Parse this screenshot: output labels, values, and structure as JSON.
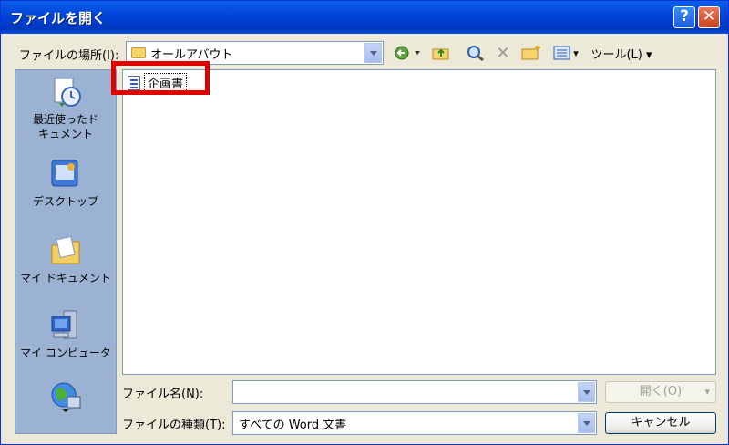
{
  "window": {
    "title": "ファイルを開く",
    "help_glyph": "?",
    "close_glyph": "✕"
  },
  "look_in": {
    "label": "ファイルの場所(I):",
    "value": "オールアバウト"
  },
  "toolbar": {
    "tools_label": "ツール(L) ▾",
    "delete_glyph": "✕",
    "dropdown_glyph": "▾"
  },
  "places": [
    {
      "label": "最近使ったド\nキュメント",
      "icon": "recent-documents-icon"
    },
    {
      "label": "デスクトップ",
      "icon": "desktop-icon"
    },
    {
      "label": "マイ ドキュメント",
      "icon": "my-documents-icon"
    },
    {
      "label": "マイ コンピュータ",
      "icon": "my-computer-icon"
    },
    {
      "label": "",
      "icon": "network-places-icon"
    }
  ],
  "files": [
    {
      "name": "企画書",
      "icon": "word-document-icon"
    }
  ],
  "file_name": {
    "label": "ファイル名(N):",
    "value": ""
  },
  "file_type": {
    "label": "ファイルの種類(T):",
    "value": "すべての Word 文書"
  },
  "buttons": {
    "open": "開く(O)",
    "open_dropdown": "▾",
    "cancel": "キャンセル"
  },
  "colors": {
    "title_bar": "#0A5FE8",
    "highlight": "#E00000",
    "sidebar": "#9CB2D3"
  }
}
